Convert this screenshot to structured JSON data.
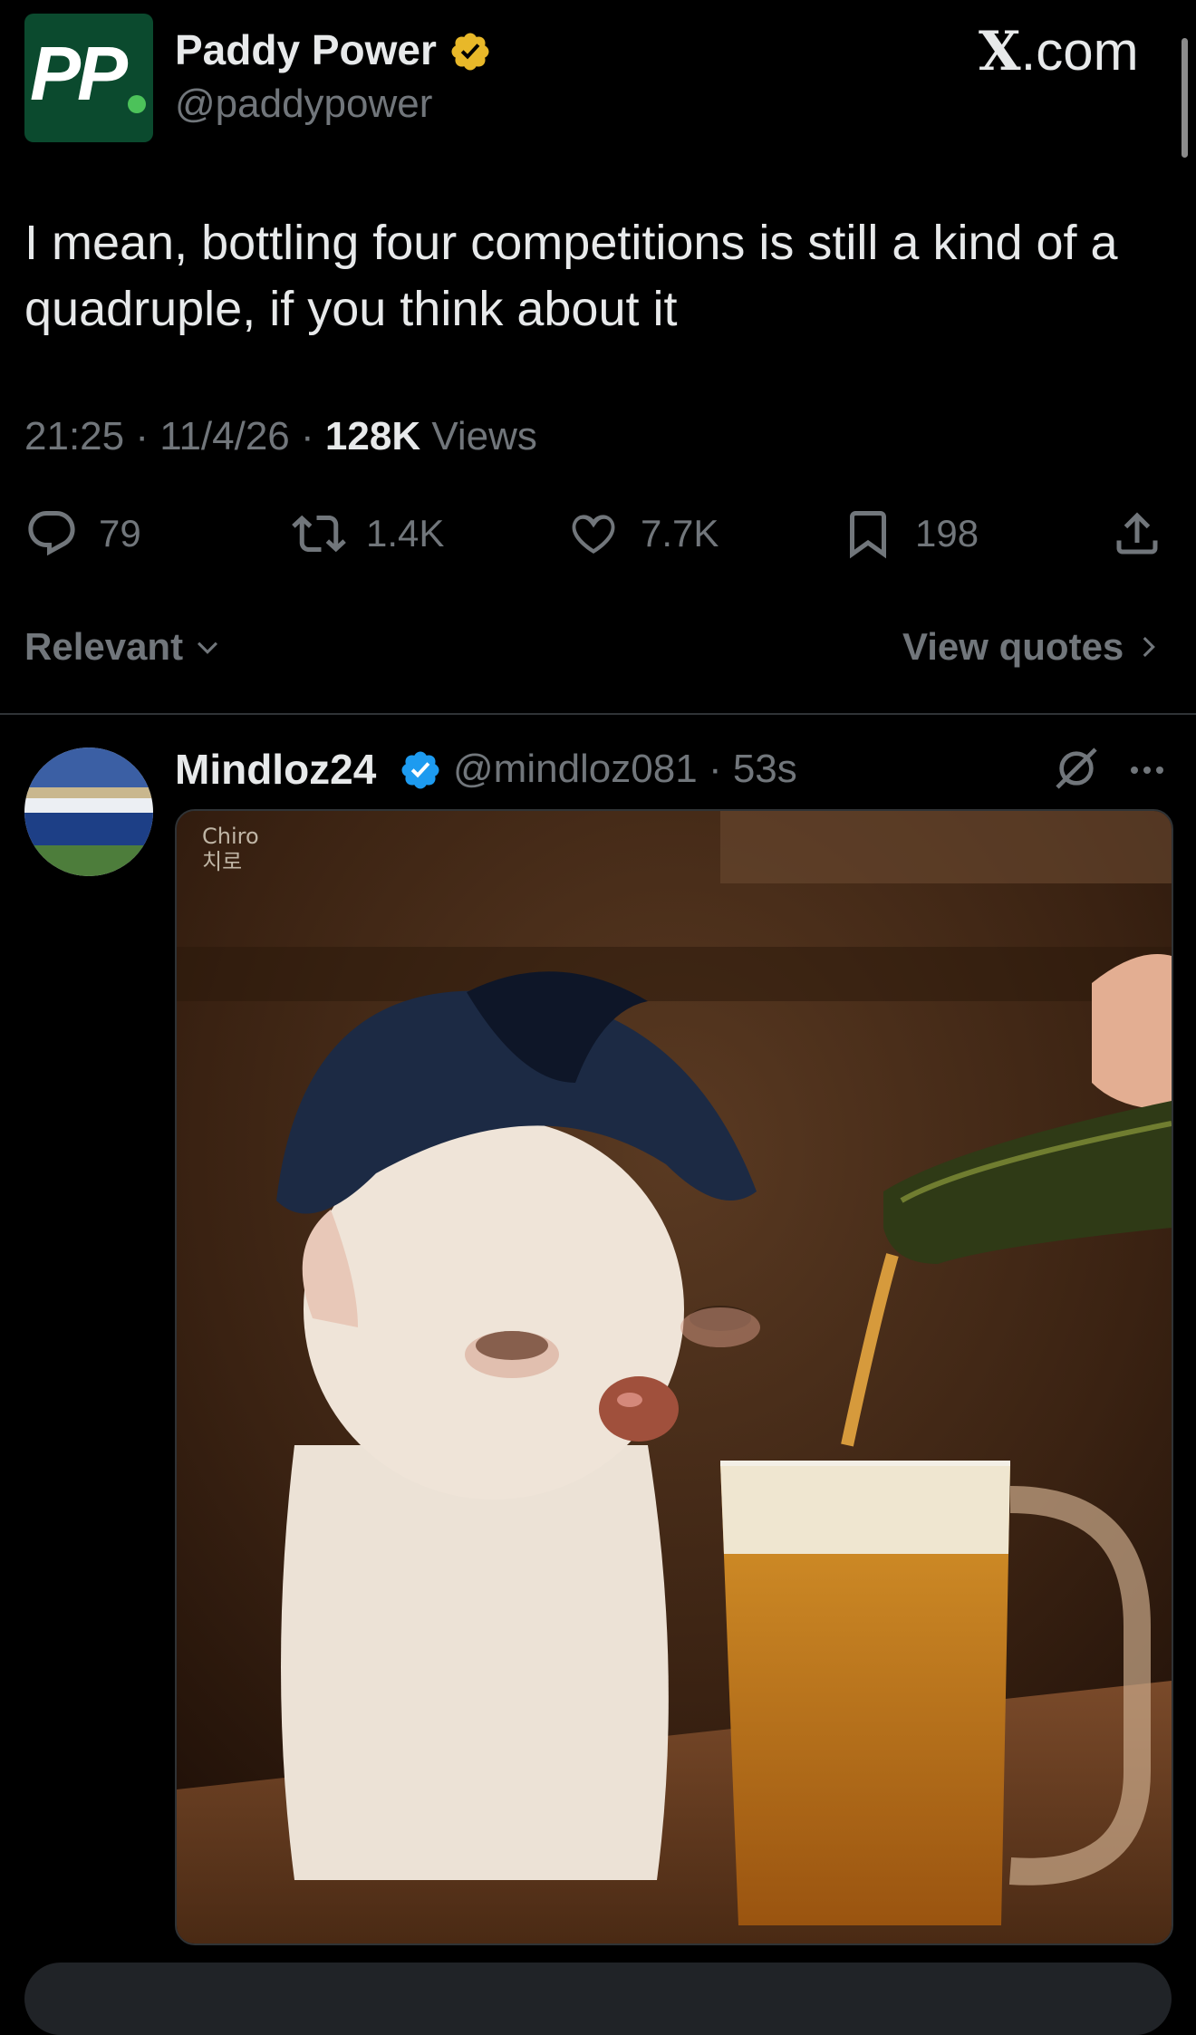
{
  "original_post": {
    "author_name": "Paddy Power",
    "author_handle": "@paddypower",
    "logo_text": "PP",
    "site": "X.com",
    "text": "I mean, bottling four competitions is still a kind of a quadruple, if you think about it",
    "time": "21:25",
    "date": "11/4/26",
    "views_count": "128K",
    "views_label": "Views",
    "sep": "·"
  },
  "actions": {
    "replies": "79",
    "reposts": "1.4K",
    "likes": "7.7K",
    "bookmarks": "198"
  },
  "sort": {
    "label": "Relevant",
    "view_quotes": "View quotes"
  },
  "reply": {
    "author_name": "Mindloz24",
    "author_handle": "@mindloz081",
    "time_ago": "53s",
    "sep": "·",
    "image_watermark_line1": "Chiro",
    "image_watermark_line2": "치로"
  },
  "colors": {
    "background": "#000000",
    "text_primary": "#e7e9ea",
    "text_secondary": "#71767b",
    "verified_gold": "#e8b829",
    "verified_blue": "#1d9bf0",
    "divider": "#2f3336"
  }
}
